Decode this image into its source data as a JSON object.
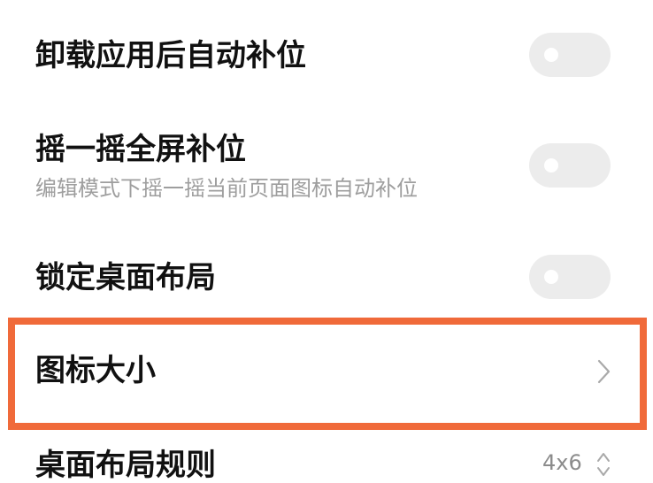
{
  "settings": {
    "auto_fill_after_uninstall": {
      "title": "卸载应用后自动补位",
      "toggle_state": "off"
    },
    "shake_fill": {
      "title": "摇一摇全屏补位",
      "subtitle": "编辑模式下摇一摇当前页面图标自动补位",
      "toggle_state": "off"
    },
    "lock_layout": {
      "title": "锁定桌面布局",
      "toggle_state": "off"
    },
    "icon_size": {
      "title": "图标大小",
      "icon": "chevron-right-icon"
    },
    "layout_rule": {
      "title": "桌面布局规则",
      "value": "4x6",
      "icon": "up-down-chevron-icon"
    }
  },
  "colors": {
    "highlight_border": "#f06a3a",
    "toggle_off_track": "#ececec",
    "subtitle_text": "#9e9e9e"
  }
}
